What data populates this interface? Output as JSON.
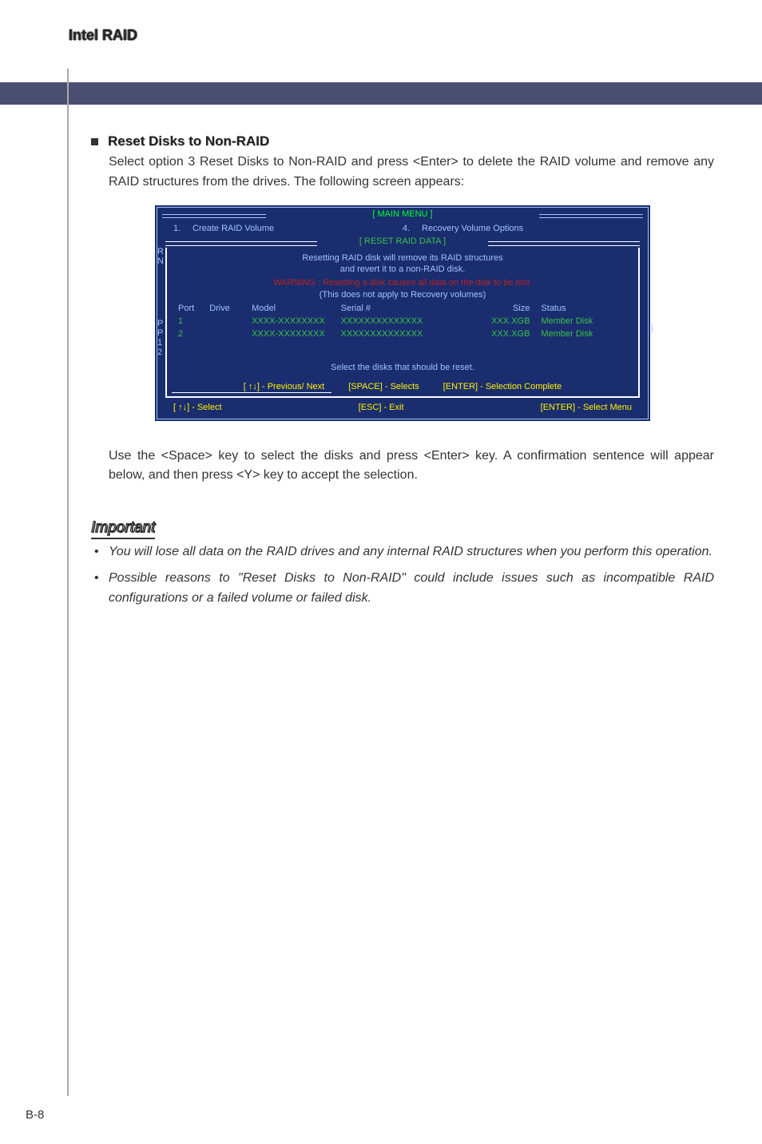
{
  "header": {
    "title": "Intel RAID"
  },
  "section": {
    "heading": "Reset Disks to Non-RAID",
    "body": "Select option 3 Reset Disks to Non-RAID and press <Enter> to delete the RAID volume and remove any RAID structures from the drives. The following screen appears:"
  },
  "bios": {
    "main_menu_label": "[    MAIN  MENU    ]",
    "menu": [
      {
        "idx": "1.",
        "label": "Create  RAID  Volume"
      },
      {
        "idx": "4.",
        "label": "Recovery Volume  Options"
      }
    ],
    "reset_title": "[  RESET  RAID  DATA  ]",
    "line1": "Resetting  RAID  disk  will  remove  its  RAID  structures",
    "line2": "and  revert  it  to  a  non-RAID  disk.",
    "warning": "WARNING : Resetting  a  disk  causes  all  data  on  the  disk  to  be  lost.",
    "line3": "(This  does  not  apply  to  Recovery  volumes)",
    "cols": {
      "port": "Port",
      "drive": "Drive",
      "model": "Model",
      "serial": "Serial  #",
      "size": "Size",
      "status": "Status"
    },
    "rows": [
      {
        "port": "1",
        "drive": "",
        "model": "XXXX-XXXXXXXX",
        "serial": "XXXXXXXXXXXXXX",
        "size": "XXX.XGB",
        "status": "Member Disk"
      },
      {
        "port": "2",
        "drive": "",
        "model": "XXXX-XXXXXXXX",
        "serial": "XXXXXXXXXXXXXX",
        "size": "XXX.XGB",
        "status": "Member Disk"
      }
    ],
    "select_prompt": "Select  the  disks  that  should  be  reset.",
    "footer": {
      "prev": "[ ↑↓] - Previous/ Next",
      "space": "[SPACE] - Selects",
      "enter": "[ENTER] - Selection Complete"
    },
    "bottom": {
      "select": "[ ↑↓] - Select",
      "esc": "[ESC] - Exit",
      "entermenu": "[ENTER] - Select Menu"
    },
    "side": [
      "R",
      "N",
      "P",
      "P",
      "1",
      "2",
      ")"
    ]
  },
  "post": {
    "text": "Use the <Space> key to select the disks and press <Enter> key. A confirmation sentence will appear below, and then press <Y> key to accept the selection."
  },
  "important": {
    "heading": "Important",
    "items": [
      "You will lose all data on the RAID drives and any internal RAID structures when you perform this operation.",
      "Possible reasons to \"Reset Disks to Non-RAID\" could include issues such as incompatible RAID configurations or a failed volume or failed disk."
    ]
  },
  "pagenum": "B-8"
}
